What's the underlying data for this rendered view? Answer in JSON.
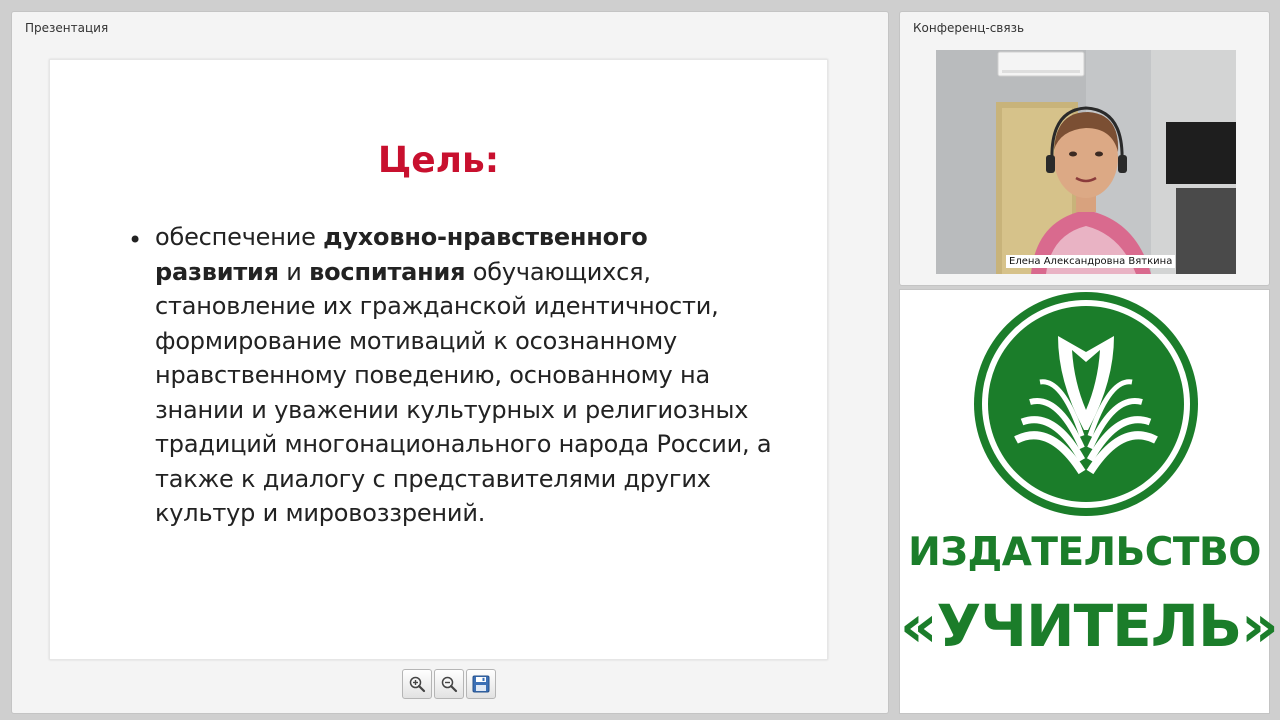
{
  "presentation": {
    "panel_title": "Презентация",
    "slide": {
      "title": "Цель:",
      "bullet": {
        "p1": "обеспечение ",
        "b1": "духовно-нравственного развития",
        "p2": " и ",
        "b2": "воспитания",
        "p3": " обучающихся, становление их гражданской идентичности, формирование мотиваций к осознанному нравственному поведению, основанному на знании и уважении культурных и религиозных традиций многонационального народа России, а также к диалогу с представителями других культур и мировоззрений."
      }
    },
    "toolbar": {
      "zoom_in_icon": "zoom-in-icon",
      "zoom_out_icon": "zoom-out-icon",
      "save_icon": "floppy-disk-icon"
    }
  },
  "conference": {
    "panel_title": "Конференц-связь",
    "participant_name": "Елена Александровна Вяткина"
  },
  "publisher": {
    "line1": "ИЗДАТЕЛЬСТВО",
    "line2": "«УЧИТЕЛЬ»",
    "brand_color": "#1b7d2a"
  }
}
